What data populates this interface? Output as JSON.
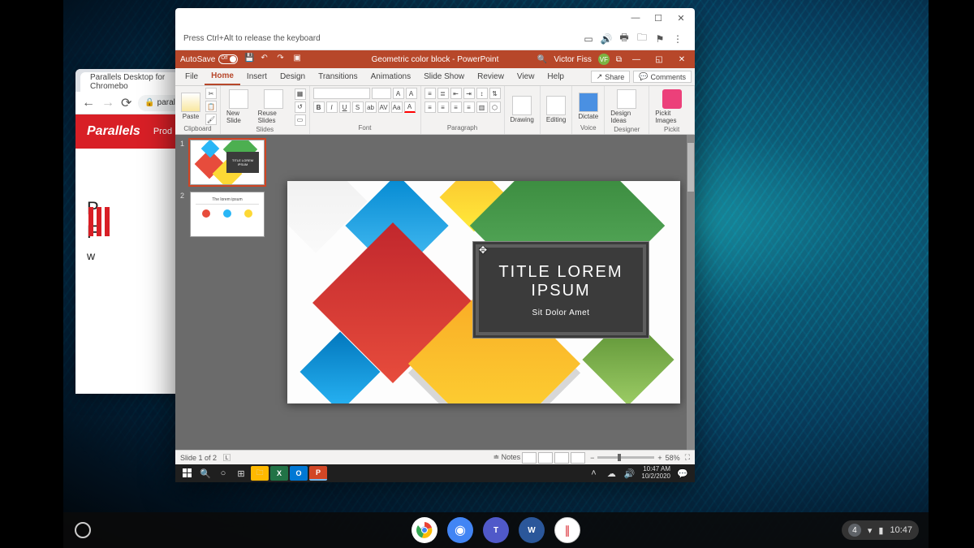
{
  "chromeos": {
    "shelf": {
      "notification_badge": "4",
      "time": "10:47"
    }
  },
  "chrome": {
    "tab_title": "Parallels Desktop for Chromebo",
    "url_lock": "🔒",
    "url": "parallels.co",
    "page": {
      "logo": "Parallels",
      "nav1": "Prod",
      "headline_line1": "P",
      "headline_line2": "F",
      "headline_line3": "w"
    }
  },
  "vm": {
    "hint": "Press Ctrl+Alt to release the keyboard"
  },
  "powerpoint": {
    "autosave_label": "AutoSave",
    "autosave_state": "Off",
    "doc_title": "Geometric color block - PowerPoint",
    "user_name": "Victor Fiss",
    "user_initials": "VF",
    "tabs": {
      "file": "File",
      "home": "Home",
      "insert": "Insert",
      "design": "Design",
      "transitions": "Transitions",
      "animations": "Animations",
      "slideshow": "Slide Show",
      "review": "Review",
      "view": "View",
      "help": "Help"
    },
    "share": "Share",
    "comments": "Comments",
    "ribbon": {
      "paste": "Paste",
      "clipboard": "Clipboard",
      "new_slide": "New Slide",
      "reuse_slides": "Reuse Slides",
      "slides": "Slides",
      "font": "Font",
      "paragraph": "Paragraph",
      "drawing": "Drawing",
      "editing": "Editing",
      "dictate": "Dictate",
      "voice": "Voice",
      "design_ideas": "Design Ideas",
      "designer": "Designer",
      "pickit_images": "Pickit Images",
      "pickit": "Pickit"
    },
    "slide": {
      "title": "TITLE LOREM IPSUM",
      "subtitle": "Sit Dolor Amet"
    },
    "thumb2_title": "The lorem ipsum",
    "status": {
      "slide_of": "Slide 1 of 2",
      "notes": "Notes",
      "zoom": "58%"
    }
  },
  "windows": {
    "time": "10:47 AM",
    "date": "10/2/2020"
  }
}
